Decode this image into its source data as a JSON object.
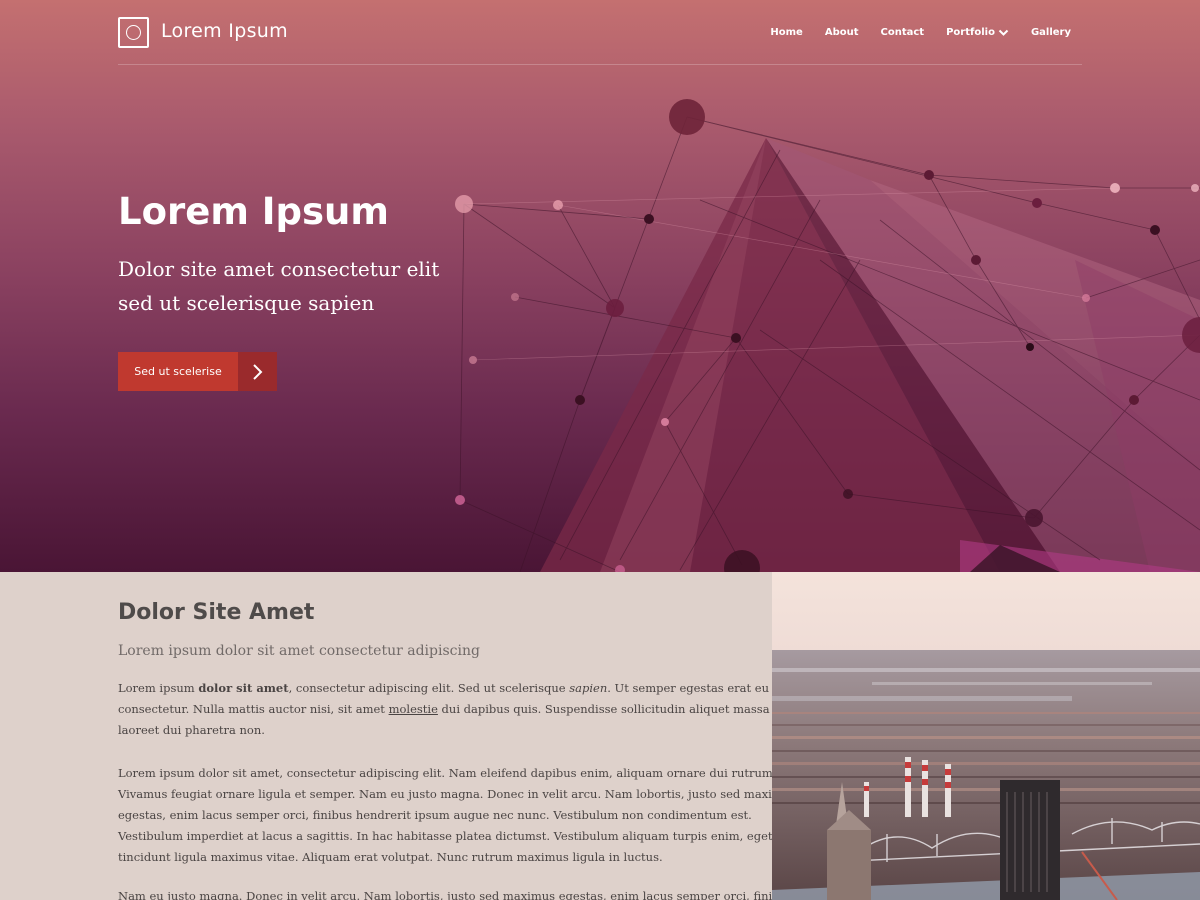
{
  "brand": {
    "name": "Lorem Ipsum",
    "logo_icon": "circle-in-square-icon"
  },
  "nav": {
    "items": [
      {
        "label": "Home"
      },
      {
        "label": "About"
      },
      {
        "label": "Contact"
      },
      {
        "label": "Portfolio",
        "has_dropdown": true
      },
      {
        "label": "Gallery"
      }
    ]
  },
  "hero": {
    "title": "Lorem Ipsum",
    "subtitle_lines": [
      "Dolor site amet consectetur elit",
      "sed ut scelerisque sapien"
    ],
    "cta_label": "Sed ut scelerise",
    "cta_icon": "chevron-right-icon",
    "background_image": "pink-mountain-network-illustration"
  },
  "section": {
    "title": "Dolor Site Amet",
    "subtitle": "Lorem ipsum dolor sit amet consectetur adipiscing",
    "p1": {
      "l1_a": "Lorem ipsum ",
      "l1_bold": "dolor sit amet",
      "l1_b": ", consectetur adipiscing elit. Sed ut scelerisque ",
      "l1_italic": "sapien",
      "l1_c": ". Ut semper egestas erat eu",
      "l2_a": "consectetur. Nulla mattis auctor nisi, sit amet ",
      "l2_underline": "molestie",
      "l2_b": " dui dapibus quis. Suspendisse sollicitudin aliquet massa eget",
      "l3": "laoreet dui pharetra non."
    },
    "p2_lines": [
      "Lorem ipsum dolor sit amet, consectetur adipiscing elit. Nam eleifend dapibus enim, aliquam ornare dui rutrum et.",
      "Vivamus feugiat ornare ligula et semper. Nam eu justo magna. Donec in velit arcu. Nam lobortis, justo sed maximus",
      "egestas, enim lacus semper orci, finibus hendrerit ipsum augue nec nunc. Vestibulum non condimentum est.",
      "Vestibulum imperdiet at lacus a sagittis. In hac habitasse platea dictumst. Vestibulum aliquam turpis enim, eget",
      "tincidunt ligula maximus vitae. Aliquam erat volutpat. Nunc rutrum maximus ligula in luctus."
    ],
    "p3_line": "Nam eu justo magna. Donec in velit arcu. Nam lobortis, justo sed maximus egestas, enim lacus semper orci, finibus",
    "side_image": "aerial-city-photo"
  },
  "colors": {
    "cta_bg": "#c0392f",
    "cta_arrow_bg": "#9a2a2c",
    "content_bg": "#ded1cb",
    "hero_top": "#c47070",
    "hero_bottom": "#4a1535"
  }
}
